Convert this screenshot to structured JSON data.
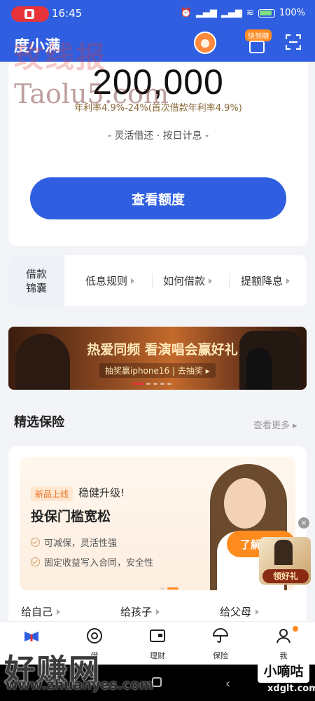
{
  "status_bar": {
    "time": "16:45",
    "battery": "100%",
    "network": "HD"
  },
  "header": {
    "app_title": "度小满",
    "gift_badge": "快到期"
  },
  "credit": {
    "amount": "200,000",
    "rate": "年利率4.9%-24%(首次借款年利率4.9%)",
    "tagline": "- 灵活借还 · 按日计息 -",
    "cta": "查看额度"
  },
  "tips": {
    "title_line1": "借款",
    "title_line2": "锦囊",
    "items": [
      "低息规则",
      "如何借款",
      "提额降息"
    ]
  },
  "banner": {
    "headline": "热爱同频 看演唱会赢好礼",
    "sub": "抽奖赢iphone16 | 去抽奖 ▸"
  },
  "section": {
    "title": "精选保险",
    "more": "查看更多 ▸"
  },
  "insurance": {
    "new_tag": "新品上线",
    "subtitle": "稳健升级!",
    "title": "投保门槛宽松",
    "features": [
      "可减保，灵活性强",
      "固定收益写入合同，安全性"
    ],
    "cta": "了解收益",
    "tabs": [
      "给自己",
      "给孩子",
      "给父母"
    ]
  },
  "float_gift": {
    "close": "×",
    "label": "领好礼"
  },
  "bottom_nav": {
    "items": [
      {
        "label": "",
        "icon": "app-logo-icon"
      },
      {
        "label": "借",
        "icon": "target-icon"
      },
      {
        "label": "理财",
        "icon": "wallet-icon"
      },
      {
        "label": "保险",
        "icon": "umbrella-icon"
      },
      {
        "label": "我",
        "icon": "person-icon"
      }
    ]
  },
  "watermarks": {
    "top_cn": "玫线报",
    "top_en": "Taolu5.com",
    "bottom_cn": "好赚网",
    "bottom_url": "www.zhuanyes.com",
    "right_cn": "小嘀咕",
    "right_url": "xdglt.com"
  },
  "colors": {
    "brand_blue": "#2f5fe0",
    "accent_orange": "#ff8a1e",
    "rate_gold": "#8a6a3a"
  }
}
